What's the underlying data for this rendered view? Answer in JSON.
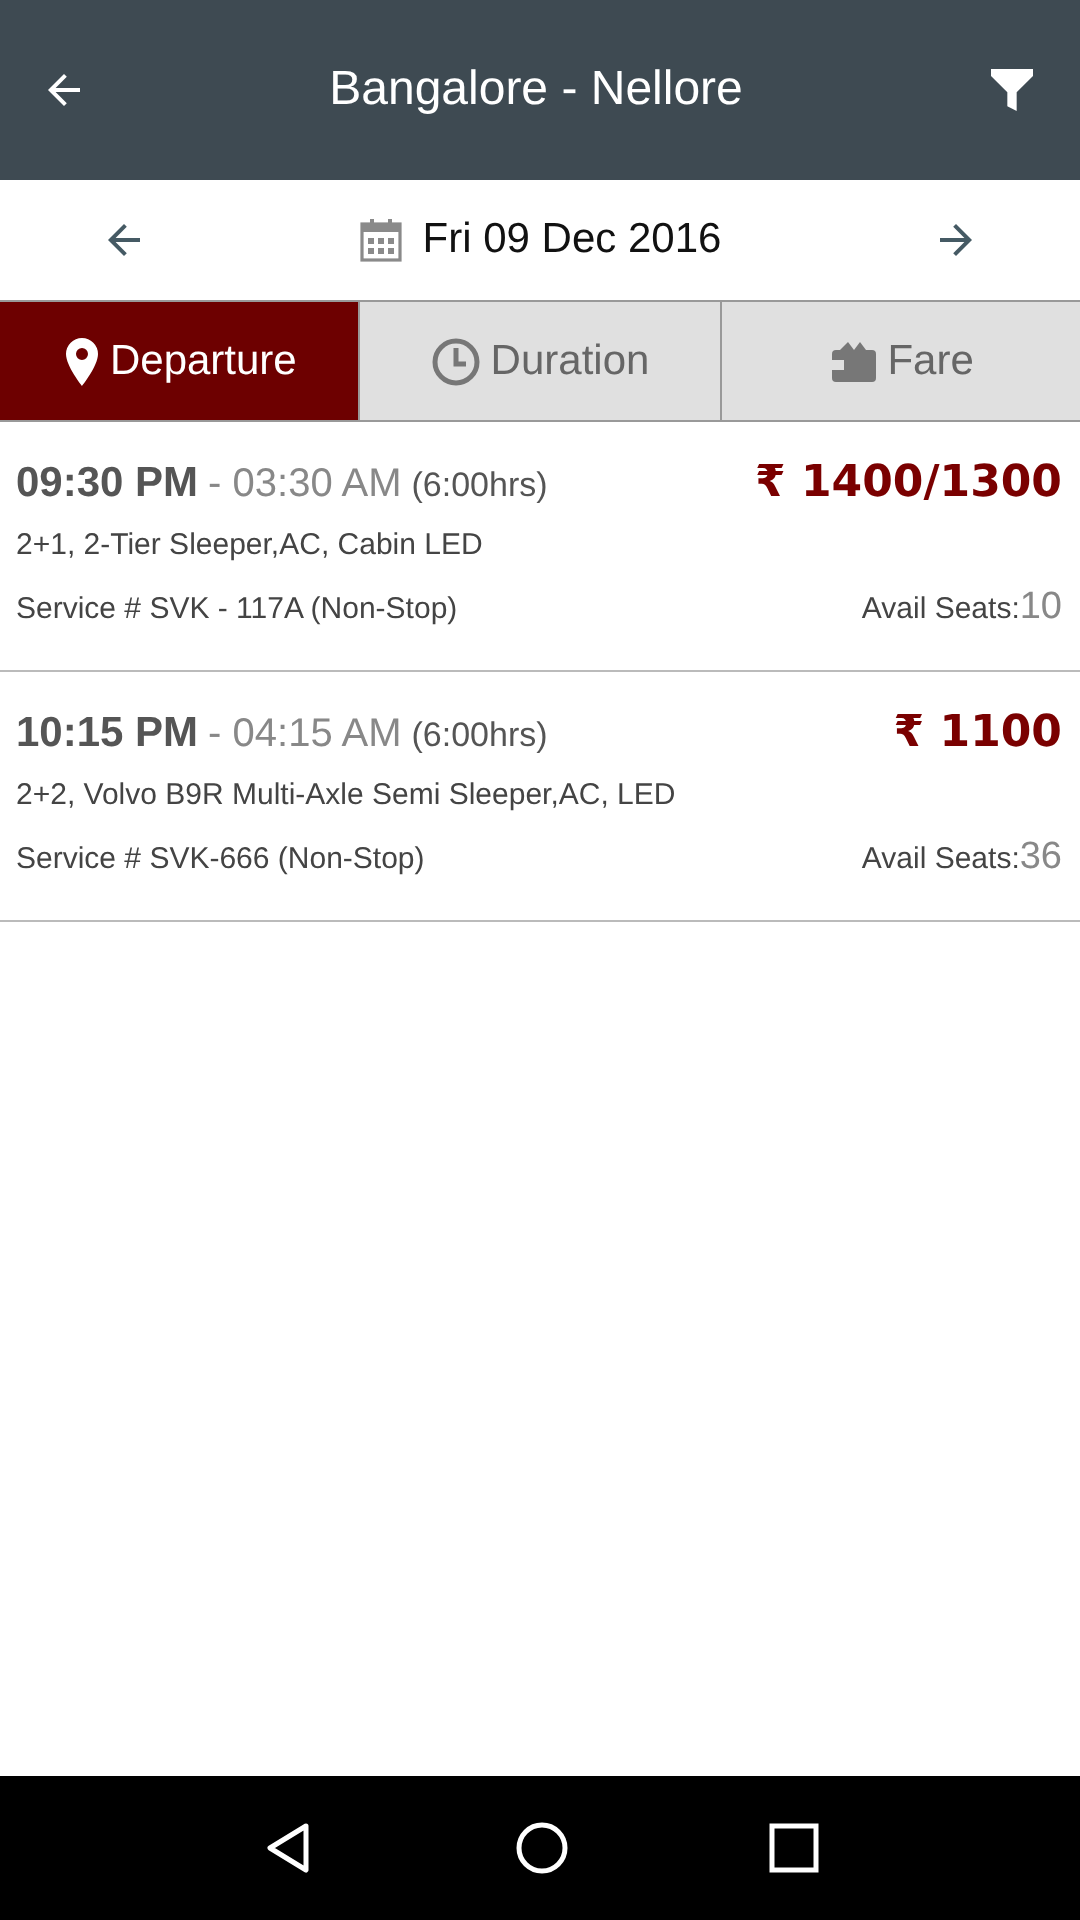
{
  "header": {
    "title": "Bangalore - Nellore"
  },
  "date_bar": {
    "date": "Fri 09 Dec 2016"
  },
  "tabs": [
    {
      "label": "Departure",
      "selected": true
    },
    {
      "label": "Duration",
      "selected": false
    },
    {
      "label": "Fare",
      "selected": false
    }
  ],
  "trips": [
    {
      "depart": "09:30 PM",
      "arrive": "- 03:30 AM",
      "duration": "(6:00hrs)",
      "price": "₹ 1400/1300",
      "bus_type": "2+1, 2-Tier Sleeper,AC, Cabin LED",
      "service": "Service # SVK - 117A (Non-Stop)",
      "seats_label": "Avail Seats:",
      "seats": "10"
    },
    {
      "depart": "10:15 PM",
      "arrive": "- 04:15 AM",
      "duration": "(6:00hrs)",
      "price": "₹ 1100",
      "bus_type": "2+2, Volvo B9R Multi-Axle Semi Sleeper,AC, LED",
      "service": "Service # SVK-666 (Non-Stop)",
      "seats_label": "Avail Seats:",
      "seats": "36"
    }
  ]
}
